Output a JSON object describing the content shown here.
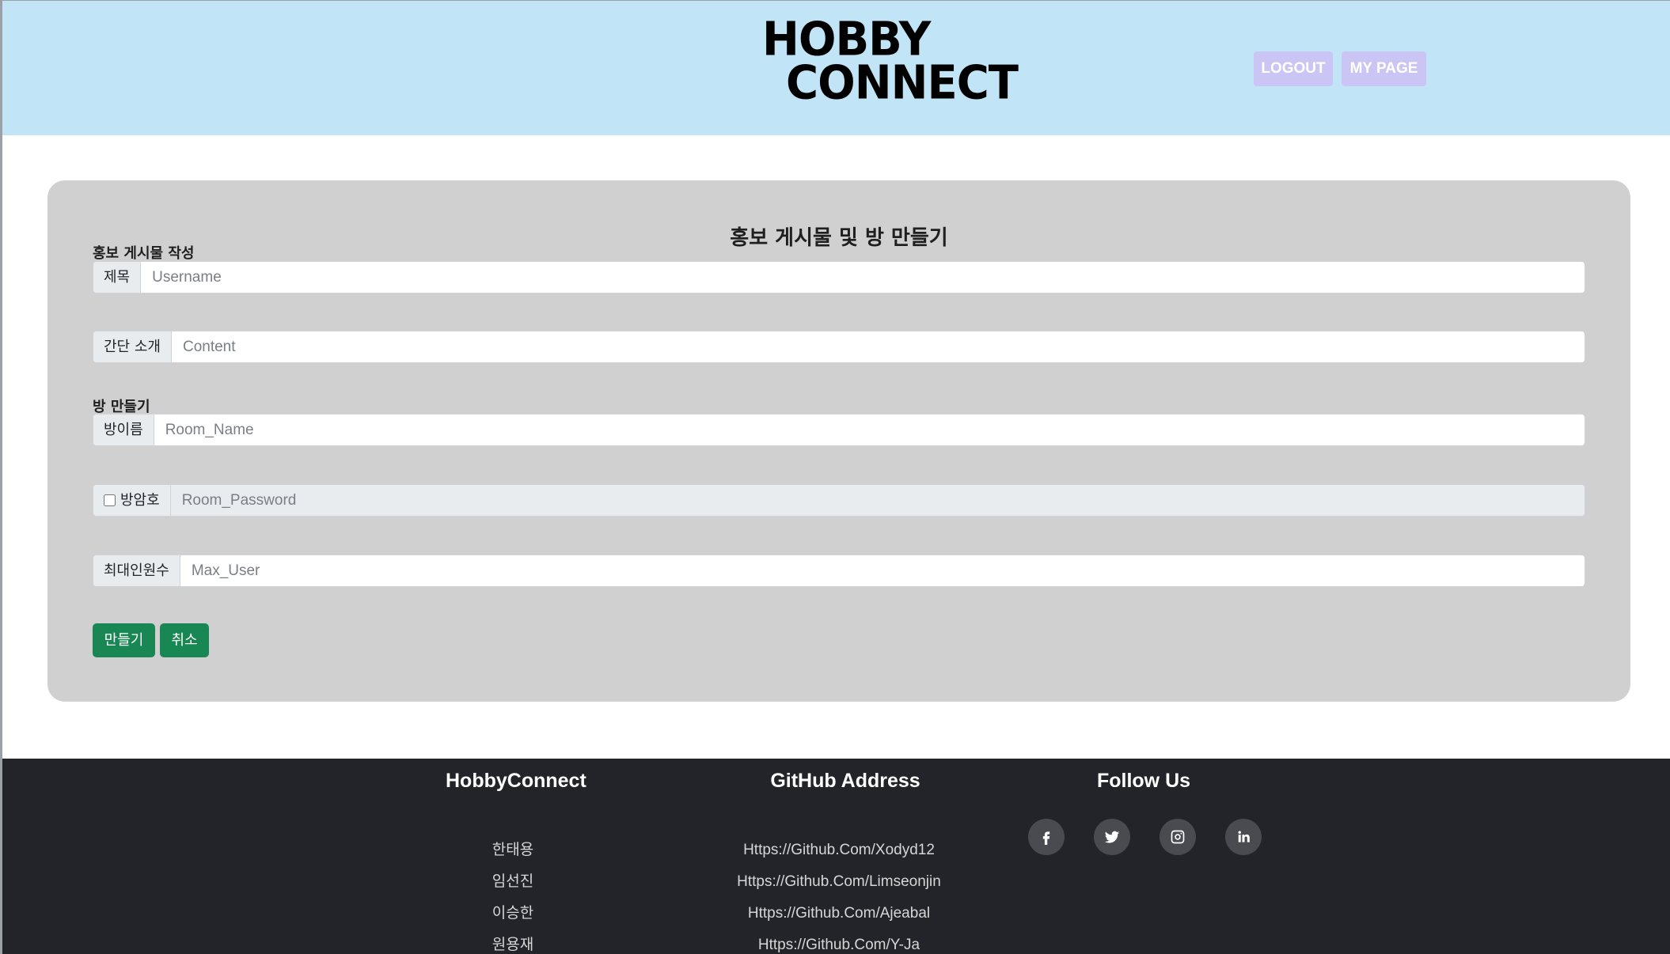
{
  "header": {
    "logo_line1": "HOBBY",
    "logo_line2": "CONNECT",
    "logout_label": "LOGOUT",
    "mypage_label": "MY PAGE"
  },
  "form": {
    "title": "홍보 게시물 및 방 만들기",
    "post_section_label": "홍보 게시물 작성",
    "title_field": {
      "label": "제목",
      "placeholder": "Username",
      "value": ""
    },
    "intro_field": {
      "label": "간단 소개",
      "placeholder": "Content",
      "value": ""
    },
    "room_section_label": "방 만들기",
    "room_name_field": {
      "label": "방이름",
      "placeholder": "Room_Name",
      "value": ""
    },
    "room_password_field": {
      "label": "방암호",
      "placeholder": "Room_Password",
      "value": "",
      "checked": false
    },
    "max_user_field": {
      "label": "최대인원수",
      "placeholder": "Max_User",
      "value": ""
    },
    "create_label": "만들기",
    "cancel_label": "취소"
  },
  "footer": {
    "col1_heading": "HobbyConnect",
    "members": [
      "한태용",
      "임선진",
      "이승한",
      "원용재"
    ],
    "col2_heading": "GitHub Address",
    "github_links": [
      "Https://Github.Com/Xodyd12",
      "Https://Github.Com/Limseonjin",
      "Https://Github.Com/Ajeabal",
      "Https://Github.Com/Y-Ja"
    ],
    "col3_heading": "Follow Us",
    "social_icons": [
      "facebook-icon",
      "twitter-icon",
      "instagram-icon",
      "linkedin-icon"
    ]
  },
  "colors": {
    "header_bg": "#c1e4f6",
    "header_button_bg": "#cbc5f5",
    "card_bg": "#d0d0d0",
    "action_button_bg": "#198754",
    "footer_bg": "#232429"
  }
}
